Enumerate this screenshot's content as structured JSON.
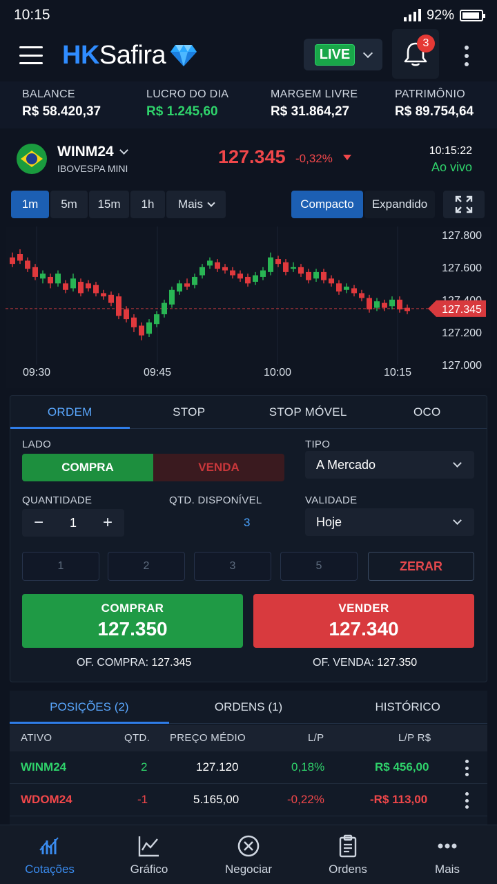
{
  "status": {
    "time": "10:15",
    "battery": "92%"
  },
  "header": {
    "logo_a": "HK",
    "logo_b": "Safira",
    "mode": "LIVE",
    "notifications": "3"
  },
  "summary": [
    {
      "label": "BALANCE",
      "value": "R$ 58.420,37",
      "green": false
    },
    {
      "label": "LUCRO DO DIA",
      "value": "R$ 1.245,60",
      "green": true
    },
    {
      "label": "MARGEM LIVRE",
      "value": "R$ 31.864,27",
      "green": false
    },
    {
      "label": "PATRIMÔNIO",
      "value": "R$ 89.754,64",
      "green": false
    }
  ],
  "instrument": {
    "symbol": "WINM24",
    "description": "IBOVESPA MINI",
    "price": "127.345",
    "change": "-0,32%",
    "time": "10:15:22",
    "status": "Ao vivo"
  },
  "timeframes": [
    "1m",
    "5m",
    "15m",
    "1h",
    "Mais"
  ],
  "views": [
    "Compacto",
    "Expandido"
  ],
  "chart_data": {
    "type": "candlestick",
    "x_ticks": [
      "09:30",
      "09:45",
      "10:00",
      "10:15"
    ],
    "y_ticks": [
      "127.800",
      "127.600",
      "127.400",
      "127.200",
      "127.000"
    ],
    "ylim": [
      127000,
      127850
    ],
    "last_price": "127.345",
    "last_value": 127345,
    "candles": [
      [
        127660,
        127620,
        127690,
        127600
      ],
      [
        127680,
        127640,
        127710,
        127620
      ],
      [
        127640,
        127590,
        127660,
        127570
      ],
      [
        127600,
        127540,
        127620,
        127520
      ],
      [
        127530,
        127560,
        127580,
        127500
      ],
      [
        127540,
        127500,
        127560,
        127470
      ],
      [
        127500,
        127560,
        127580,
        127480
      ],
      [
        127500,
        127460,
        127520,
        127440
      ],
      [
        127470,
        127530,
        127560,
        127450
      ],
      [
        127510,
        127440,
        127530,
        127420
      ],
      [
        127500,
        127470,
        127520,
        127450
      ],
      [
        127490,
        127440,
        127510,
        127420
      ],
      [
        127440,
        127420,
        127460,
        127400
      ],
      [
        127430,
        127380,
        127450,
        127360
      ],
      [
        127420,
        127300,
        127440,
        127280
      ],
      [
        127340,
        127280,
        127360,
        127260
      ],
      [
        127290,
        127230,
        127310,
        127200
      ],
      [
        127240,
        127180,
        127260,
        127150
      ],
      [
        127190,
        127260,
        127280,
        127170
      ],
      [
        127250,
        127310,
        127330,
        127230
      ],
      [
        127310,
        127380,
        127400,
        127290
      ],
      [
        127370,
        127460,
        127480,
        127350
      ],
      [
        127450,
        127500,
        127520,
        127430
      ],
      [
        127500,
        127480,
        127530,
        127460
      ],
      [
        127490,
        127540,
        127560,
        127470
      ],
      [
        127550,
        127600,
        127620,
        127530
      ],
      [
        127610,
        127640,
        127660,
        127590
      ],
      [
        127630,
        127590,
        127650,
        127570
      ],
      [
        127600,
        127580,
        127620,
        127560
      ],
      [
        127580,
        127550,
        127600,
        127530
      ],
      [
        127560,
        127530,
        127580,
        127510
      ],
      [
        127540,
        127500,
        127560,
        127480
      ],
      [
        127510,
        127550,
        127570,
        127490
      ],
      [
        127540,
        127580,
        127600,
        127520
      ],
      [
        127570,
        127660,
        127690,
        127550
      ],
      [
        127650,
        127620,
        127670,
        127600
      ],
      [
        127630,
        127570,
        127650,
        127550
      ],
      [
        127590,
        127600,
        127630,
        127570
      ],
      [
        127600,
        127560,
        127620,
        127540
      ],
      [
        127570,
        127520,
        127590,
        127500
      ],
      [
        127530,
        127570,
        127590,
        127510
      ],
      [
        127570,
        127520,
        127590,
        127500
      ],
      [
        127530,
        127500,
        127550,
        127480
      ],
      [
        127500,
        127450,
        127520,
        127430
      ],
      [
        127460,
        127480,
        127500,
        127440
      ],
      [
        127470,
        127440,
        127490,
        127420
      ],
      [
        127440,
        127410,
        127460,
        127390
      ],
      [
        127410,
        127340,
        127430,
        127320
      ],
      [
        127350,
        127390,
        127410,
        127330
      ],
      [
        127380,
        127350,
        127400,
        127330
      ],
      [
        127360,
        127400,
        127420,
        127340
      ],
      [
        127400,
        127340,
        127420,
        127320
      ],
      [
        127350,
        127330,
        127370,
        127310
      ]
    ]
  },
  "order": {
    "tabs": [
      "ORDEM",
      "STOP",
      "STOP MÓVEL",
      "OCO"
    ],
    "side_label": "LADO",
    "buy": "COMPRA",
    "sell": "VENDA",
    "type_label": "TIPO",
    "type_value": "A Mercado",
    "qty_label": "QUANTIDADE",
    "qty_value": "1",
    "avail_label": "QTD. DISPONÍVEL",
    "avail_value": "3",
    "validity_label": "VALIDADE",
    "validity_value": "Hoje",
    "quick": [
      "1",
      "2",
      "3",
      "5"
    ],
    "zero": "ZERAR",
    "buy_btn": "COMPRAR",
    "buy_price": "127.350",
    "sell_btn": "VENDER",
    "sell_price": "127.340",
    "offer_buy_label": "OF. COMPRA:",
    "offer_buy_value": "127.345",
    "offer_sell_label": "OF. VENDA:",
    "offer_sell_value": "127.350"
  },
  "positions": {
    "tabs": [
      "POSIÇÕES (2)",
      "ORDENS (1)",
      "HISTÓRICO"
    ],
    "headers": [
      "ATIVO",
      "QTD.",
      "PREÇO MÉDIO",
      "L/P",
      "L/P R$"
    ],
    "rows": [
      {
        "asset": "WINM24",
        "qty": "2",
        "avg": "127.120",
        "pl": "0,18%",
        "plv": "R$ 456,00",
        "up": true
      },
      {
        "asset": "WDOM24",
        "qty": "-1",
        "avg": "5.165,00",
        "pl": "-0,22%",
        "plv": "-R$ 113,00",
        "up": false
      }
    ]
  },
  "nav": [
    "Cotações",
    "Gráfico",
    "Negociar",
    "Ordens",
    "Mais"
  ],
  "colors": {
    "green": "#2fd36b",
    "red": "#f0474a",
    "accent": "#2f7de8"
  }
}
